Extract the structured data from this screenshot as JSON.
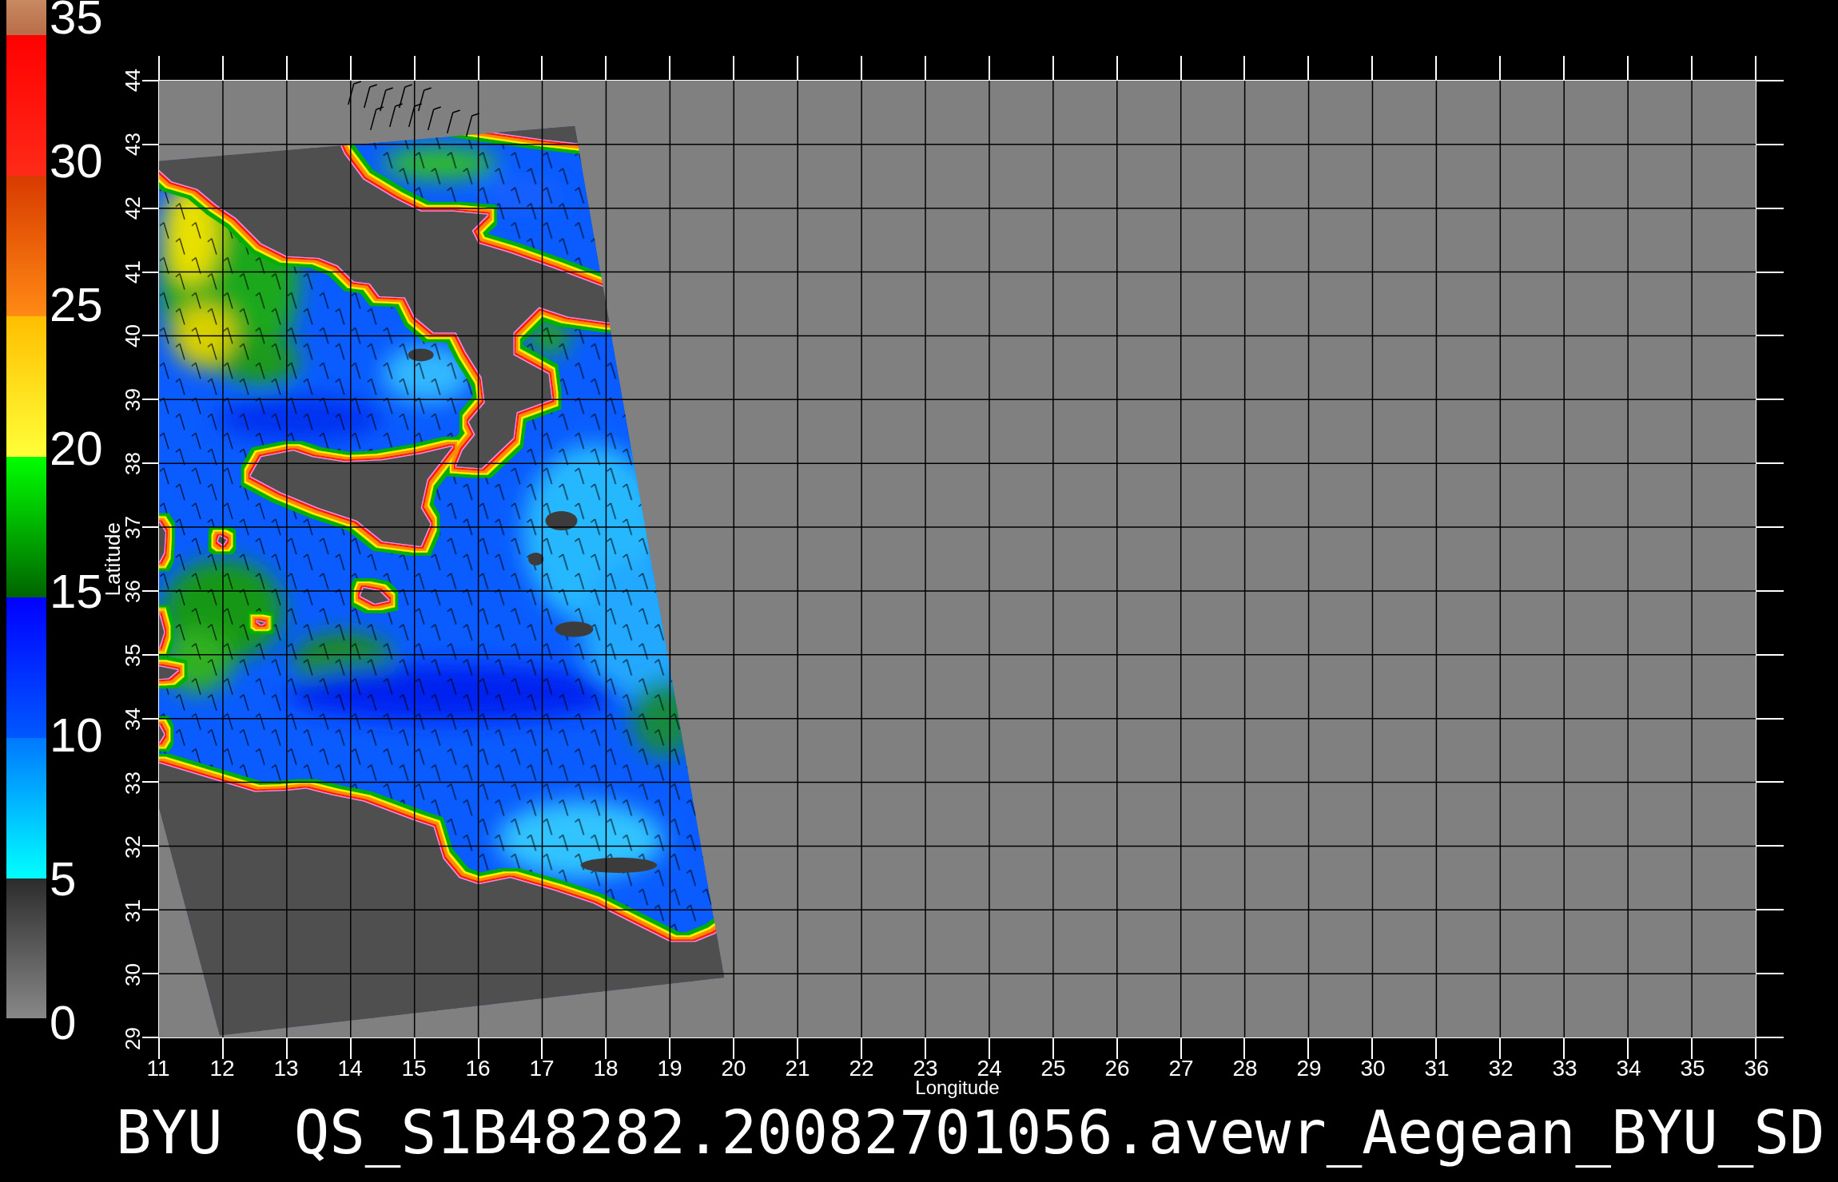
{
  "colorbar": {
    "labels": [
      "35",
      "30",
      "25",
      "20",
      "15",
      "10",
      "5",
      "0"
    ]
  },
  "plot": {
    "ylabel": "Latitude",
    "yticks": [
      "44",
      "43",
      "42",
      "41",
      "40",
      "39",
      "38",
      "37",
      "36",
      "35",
      "34",
      "33",
      "32",
      "31",
      "30",
      "29"
    ],
    "xticks": [
      "11",
      "12",
      "13",
      "14",
      "15",
      "16",
      "17",
      "18",
      "19",
      "20",
      "21",
      "22",
      "23",
      "24",
      "25",
      "26",
      "27",
      "28",
      "29",
      "30",
      "31",
      "32",
      "33",
      "34",
      "35",
      "36"
    ],
    "xlabel": "Longitude"
  },
  "title": "BYU  QS_S1B48282.20082701056.avewr_Aegean_BYU_SD"
}
